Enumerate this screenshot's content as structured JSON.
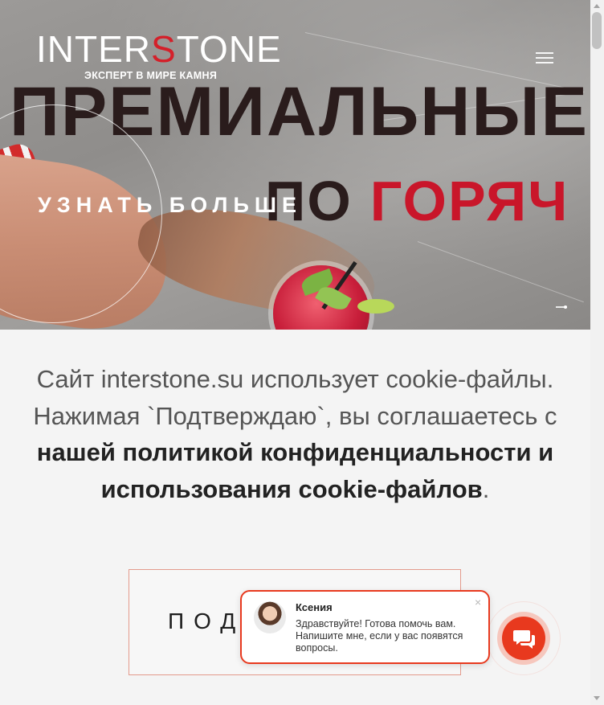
{
  "hero": {
    "logo": {
      "text_before": "INTER",
      "text_s": "S",
      "text_after": "TONE",
      "tagline": "ЭКСПЕРТ В МИРЕ КАМНЯ"
    },
    "promo_line1": "ПРЕМИАЛЬНЫЕ",
    "promo_line2_a": "ПО",
    "promo_line2_b": "ГОРЯЧ",
    "learn_more": "УЗНАТЬ БОЛЬШЕ",
    "menu_icon": "hamburger-icon"
  },
  "cookie": {
    "text": "Сайт interstone.su использует cookie-файлы. Нажимая `Подтверждаю`, вы соглашаетесь с ",
    "link": "нашей политикой конфиденциальности и использования cookie-файлов",
    "end": ".",
    "confirm_label": "ПОДТ"
  },
  "chat": {
    "agent_name": "Ксения",
    "message": "Здравствуйте! Готова помочь вам. Напишите мне, если у вас появятся вопросы.",
    "close_glyph": "×",
    "button_icon": "chat-icon"
  },
  "colors": {
    "accent": "#e8391e",
    "brand_red": "#c9162a"
  }
}
